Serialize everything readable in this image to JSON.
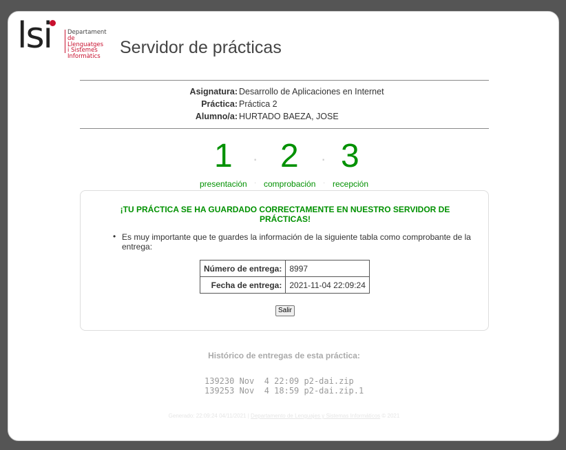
{
  "header": {
    "logo_mark": "lsi",
    "logo_lines": [
      "Departament",
      "de Llenguatges",
      "i Sistemes",
      "Informàtics"
    ],
    "title": "Servidor de prácticas"
  },
  "info": [
    {
      "label": "Asignatura:",
      "value": "Desarrollo de Aplicaciones en Internet"
    },
    {
      "label": "Práctica:",
      "value": "Práctica 2"
    },
    {
      "label": "Alumno/a:",
      "value": "HURTADO BAEZA, JOSE"
    }
  ],
  "steps": [
    {
      "number": "1",
      "label": "presentación"
    },
    {
      "number": "2",
      "label": "comprobación"
    },
    {
      "number": "3",
      "label": "recepción"
    }
  ],
  "result": {
    "message": "¡TU PRÁCTICA SE HA GUARDADO CORRECTAMENTE EN NUESTRO SERVIDOR DE PRÁCTICAS!",
    "notice": "Es muy importante que te guardes la información de la siguiente tabla como comprobante de la entrega:",
    "receipt": [
      {
        "key": "Número de entrega:",
        "value": "8997"
      },
      {
        "key": "Fecha de entrega:",
        "value": "2021-11-04 22:09:24"
      }
    ],
    "exit_button": "Salir"
  },
  "history": {
    "title": "Histórico de entregas de esta práctica:",
    "entries": [
      "139230 Nov  4 22:09 p2-dai.zip",
      "139253 Nov  4 18:59 p2-dai.zip.1"
    ]
  },
  "footer": {
    "generated": "Generado: 22:09:24 04/11/2021 |",
    "link": "Departamento de Lenguajes y Sistemas Informáticos",
    "copyright": "© 2021"
  },
  "colors": {
    "accent_green": "#009100",
    "brand_red": "#c8102e",
    "frame": "#555555"
  }
}
